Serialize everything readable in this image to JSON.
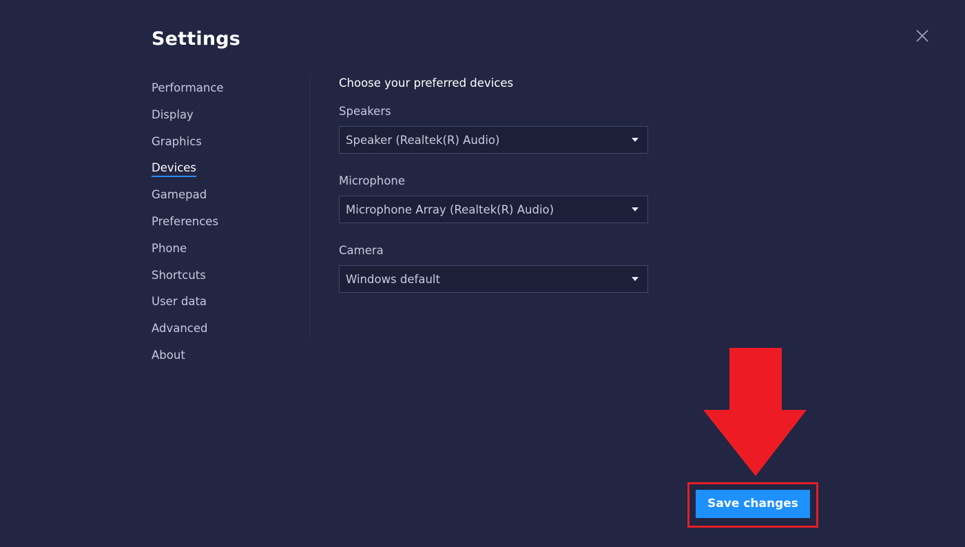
{
  "window": {
    "title": "Settings",
    "close_icon": "close-icon"
  },
  "sidebar": {
    "active": "Devices",
    "items": [
      {
        "label": "Performance"
      },
      {
        "label": "Display"
      },
      {
        "label": "Graphics"
      },
      {
        "label": "Devices"
      },
      {
        "label": "Gamepad"
      },
      {
        "label": "Preferences"
      },
      {
        "label": "Phone"
      },
      {
        "label": "Shortcuts"
      },
      {
        "label": "User data"
      },
      {
        "label": "Advanced"
      },
      {
        "label": "About"
      }
    ]
  },
  "devices": {
    "heading": "Choose your preferred devices",
    "speakers": {
      "label": "Speakers",
      "value": "Speaker (Realtek(R) Audio)"
    },
    "microphone": {
      "label": "Microphone",
      "value": "Microphone Array (Realtek(R) Audio)"
    },
    "camera": {
      "label": "Camera",
      "value": "Windows default"
    }
  },
  "footer": {
    "save_label": "Save changes"
  },
  "annotation": {
    "arrow_icon": "arrow-down-icon",
    "arrow_color": "#ed1c24",
    "box_color": "#e51e25"
  },
  "colors": {
    "background": "#222642",
    "accent": "#1e90ff",
    "active_underline": "#2b8cff"
  }
}
